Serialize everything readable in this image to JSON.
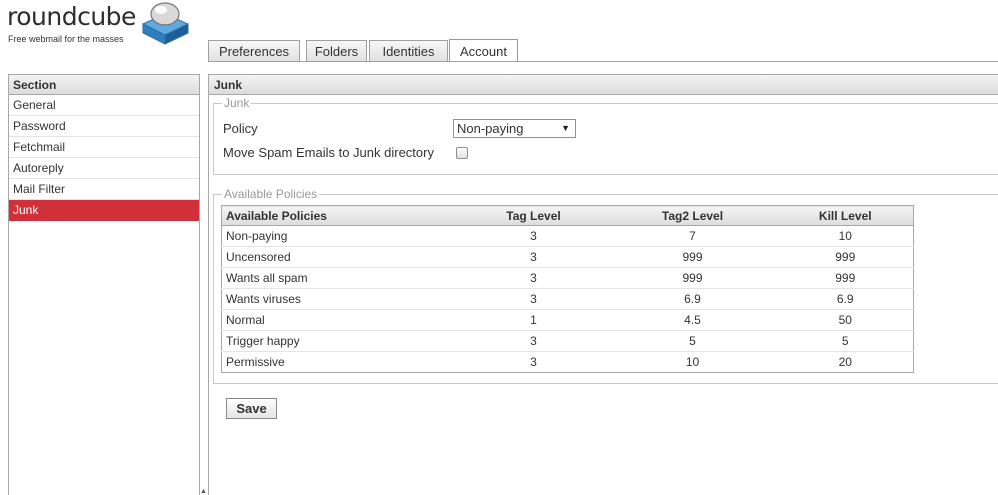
{
  "brand": {
    "name": "roundcube",
    "tagline": "Free webmail for the masses"
  },
  "tabs": [
    {
      "label": "Preferences",
      "active": false
    },
    {
      "label": "Folders",
      "active": false
    },
    {
      "label": "Identities",
      "active": false
    },
    {
      "label": "Account",
      "active": true
    }
  ],
  "sidebar": {
    "header": "Section",
    "items": [
      {
        "label": "General",
        "selected": false
      },
      {
        "label": "Password",
        "selected": false
      },
      {
        "label": "Fetchmail",
        "selected": false
      },
      {
        "label": "Autoreply",
        "selected": false
      },
      {
        "label": "Mail Filter",
        "selected": false
      },
      {
        "label": "Junk",
        "selected": true
      }
    ]
  },
  "main": {
    "title": "Junk",
    "junk_fieldset": {
      "legend": "Junk",
      "policy_label": "Policy",
      "policy_value": "Non-paying",
      "move_spam_label": "Move Spam Emails to Junk directory",
      "move_spam_checked": false
    },
    "policies_fieldset": {
      "legend": "Available Policies",
      "columns": [
        "Available Policies",
        "Tag Level",
        "Tag2 Level",
        "Kill Level"
      ],
      "rows": [
        {
          "name": "Non-paying",
          "tag": "3",
          "tag2": "7",
          "kill": "10"
        },
        {
          "name": "Uncensored",
          "tag": "3",
          "tag2": "999",
          "kill": "999"
        },
        {
          "name": "Wants all spam",
          "tag": "3",
          "tag2": "999",
          "kill": "999"
        },
        {
          "name": "Wants viruses",
          "tag": "3",
          "tag2": "6.9",
          "kill": "6.9"
        },
        {
          "name": "Normal",
          "tag": "1",
          "tag2": "4.5",
          "kill": "50"
        },
        {
          "name": "Trigger happy",
          "tag": "3",
          "tag2": "5",
          "kill": "5"
        },
        {
          "name": "Permissive",
          "tag": "3",
          "tag2": "10",
          "kill": "20"
        }
      ]
    },
    "save_label": "Save"
  },
  "colors": {
    "selected": "#d0303a",
    "select_border": "#6d9acf"
  }
}
